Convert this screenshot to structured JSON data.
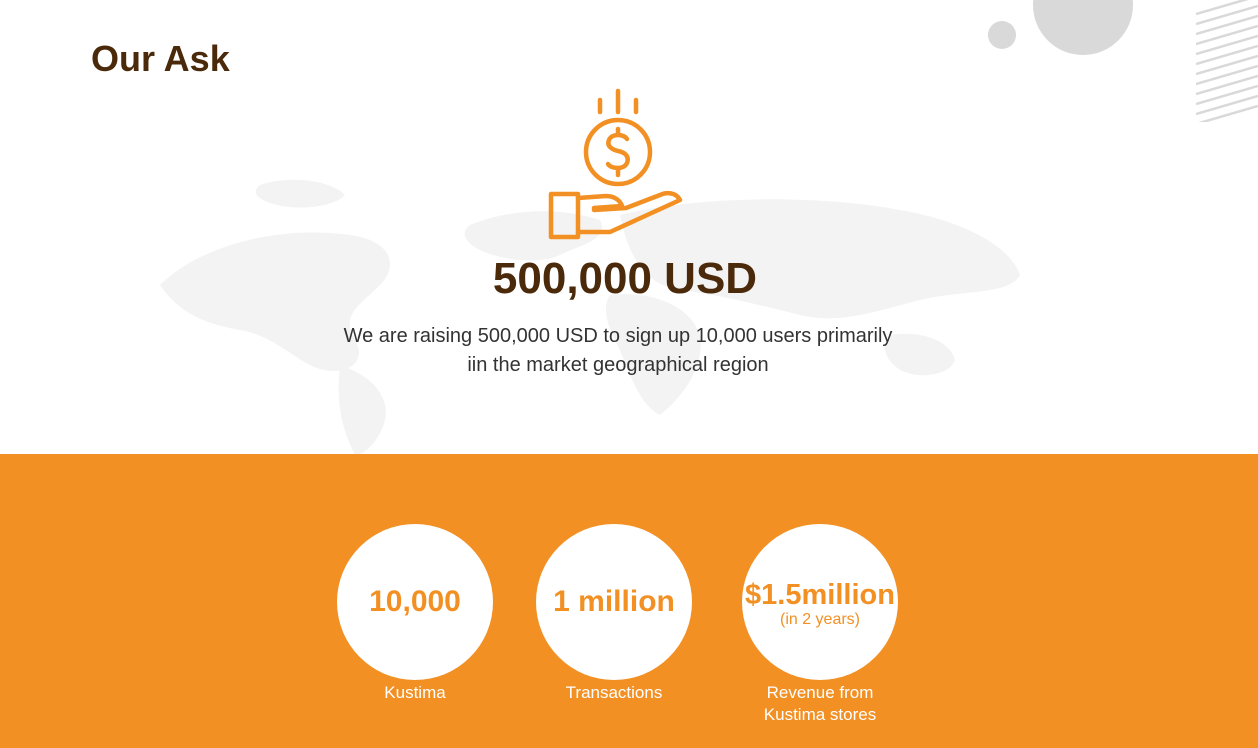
{
  "header": {
    "title": "Our Ask"
  },
  "ask": {
    "amount": "500,000 USD",
    "description_line1": "We are raising 500,000 USD to sign up 10,000 users primarily",
    "description_line2": "iin the market geographical region",
    "icon": "hand-holding-dollar-icon"
  },
  "stats": [
    {
      "value": "10,000",
      "label": "Kustima"
    },
    {
      "value": "1 million",
      "label": "Transactions"
    },
    {
      "value": "$1.5million",
      "note": "(in 2 years)",
      "label_line1": "Revenue from",
      "label_line2": "Kustima stores"
    }
  ],
  "colors": {
    "accent": "#f29024",
    "heading": "#4a2a0a",
    "text": "#333333",
    "decoration": "#d9d9d9"
  }
}
